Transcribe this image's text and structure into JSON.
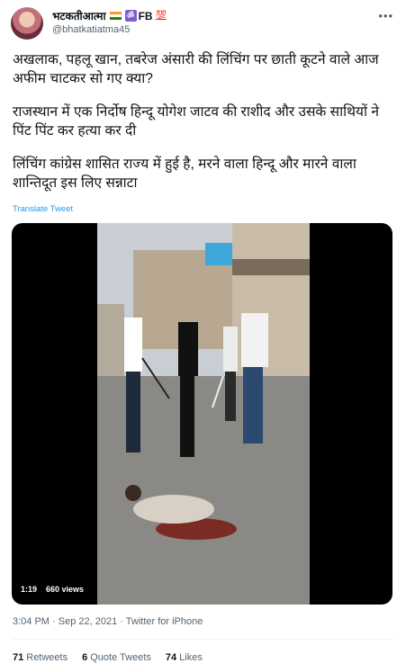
{
  "author": {
    "display_name": "भटकतीआत्मा",
    "badge_fb": "FB",
    "badge_100": "💯",
    "handle": "@bhatkatiatma45"
  },
  "tweet": {
    "paragraphs": [
      "अखलाक, पहलू खान, तबरेज अंसारी की लिंचिंग पर छाती कूटने वाले आज अफीम चाटकर सो गए क्या?",
      "राजस्थान में एक निर्दोष हिन्दू योगेश जाटव की  राशीद और उसके साथियों ने पिंट पिंट कर हत्या कर दी",
      "लिंचिंग कांग्रेस शासित राज्य में हुई है, मरने वाला हिन्दू और मारने वाला शान्तिदूत इस लिए सन्नाटा"
    ],
    "translate_label": "Translate Tweet"
  },
  "video": {
    "duration": "1:19",
    "views": "660 views"
  },
  "meta": {
    "time": "3:04 PM",
    "date": "Sep 22, 2021",
    "source": "Twitter for iPhone",
    "full": "3:04 PM · Sep 22, 2021 · Twitter for iPhone"
  },
  "stats": {
    "retweets_count": "71",
    "retweets_label": "Retweets",
    "quotes_count": "6",
    "quotes_label": "Quote Tweets",
    "likes_count": "74",
    "likes_label": "Likes"
  },
  "colors": {
    "accent": "#1d9bf0",
    "muted": "#536471",
    "text": "#0f1419"
  }
}
